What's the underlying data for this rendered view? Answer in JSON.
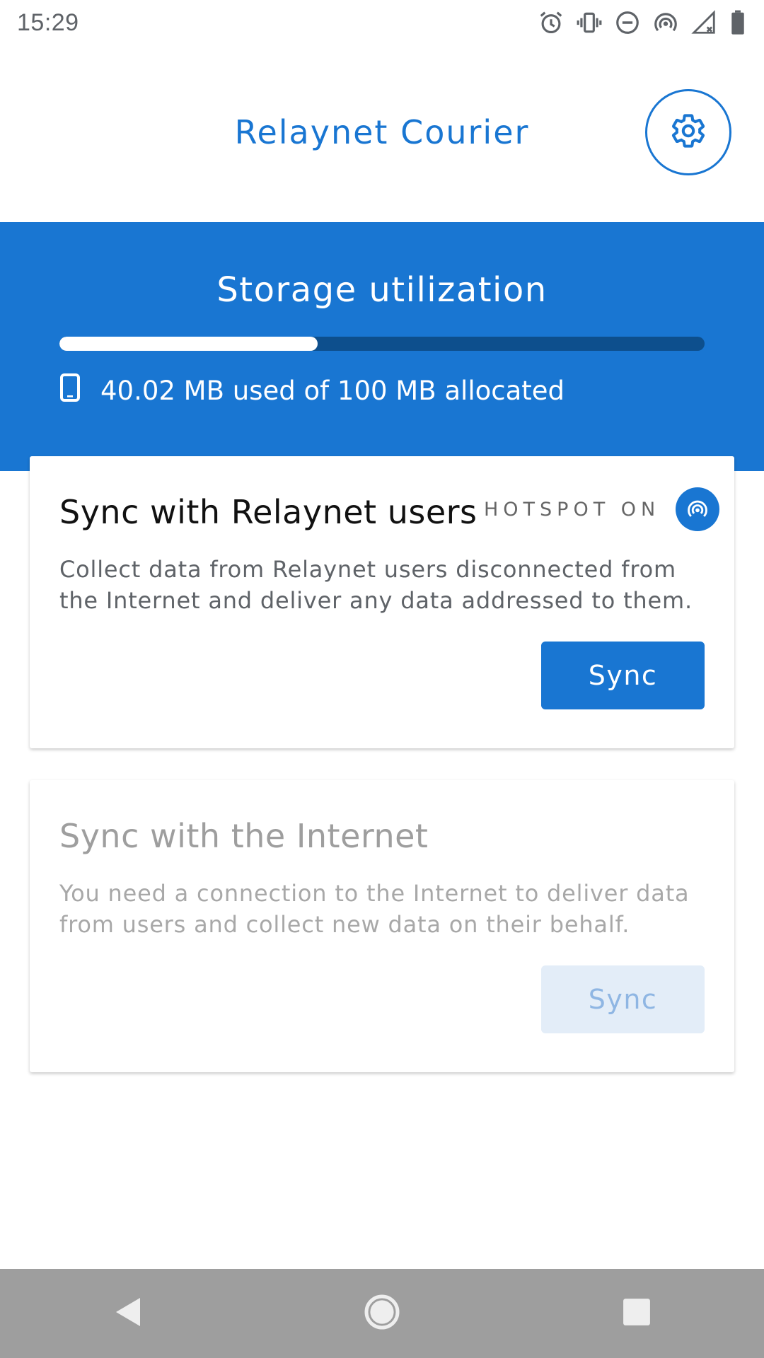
{
  "status_bar": {
    "time": "15:29",
    "icons": [
      "alarm-icon",
      "vibrate-icon",
      "do-not-disturb-icon",
      "hotspot-icon",
      "signal-icon",
      "battery-icon"
    ]
  },
  "app_bar": {
    "title": "Relaynet Courier",
    "settings_icon": "gear-icon"
  },
  "storage": {
    "title": "Storage utilization",
    "used_fraction": 0.4002,
    "info": "40.02 MB used of 100 MB allocated",
    "icon": "phone-icon"
  },
  "cards": {
    "users": {
      "title": "Sync with Relaynet users",
      "hotspot_label": "HOTSPOT ON",
      "description": "Collect data from Relaynet users disconnected from the Internet and deliver any data addressed to them.",
      "button_label": "Sync"
    },
    "internet": {
      "title": "Sync with the Internet",
      "description": "You need a connection to the Internet to deliver data from users and collect new data on their behalf.",
      "button_label": "Sync"
    }
  },
  "nav_bar": {
    "buttons": [
      "back-icon",
      "home-icon",
      "recents-icon"
    ]
  },
  "colors": {
    "primary": "#1976d2",
    "progress_track": "#0d4f8d",
    "disabled_button": "#e3edf8",
    "nav_bar": "#9e9e9e"
  }
}
